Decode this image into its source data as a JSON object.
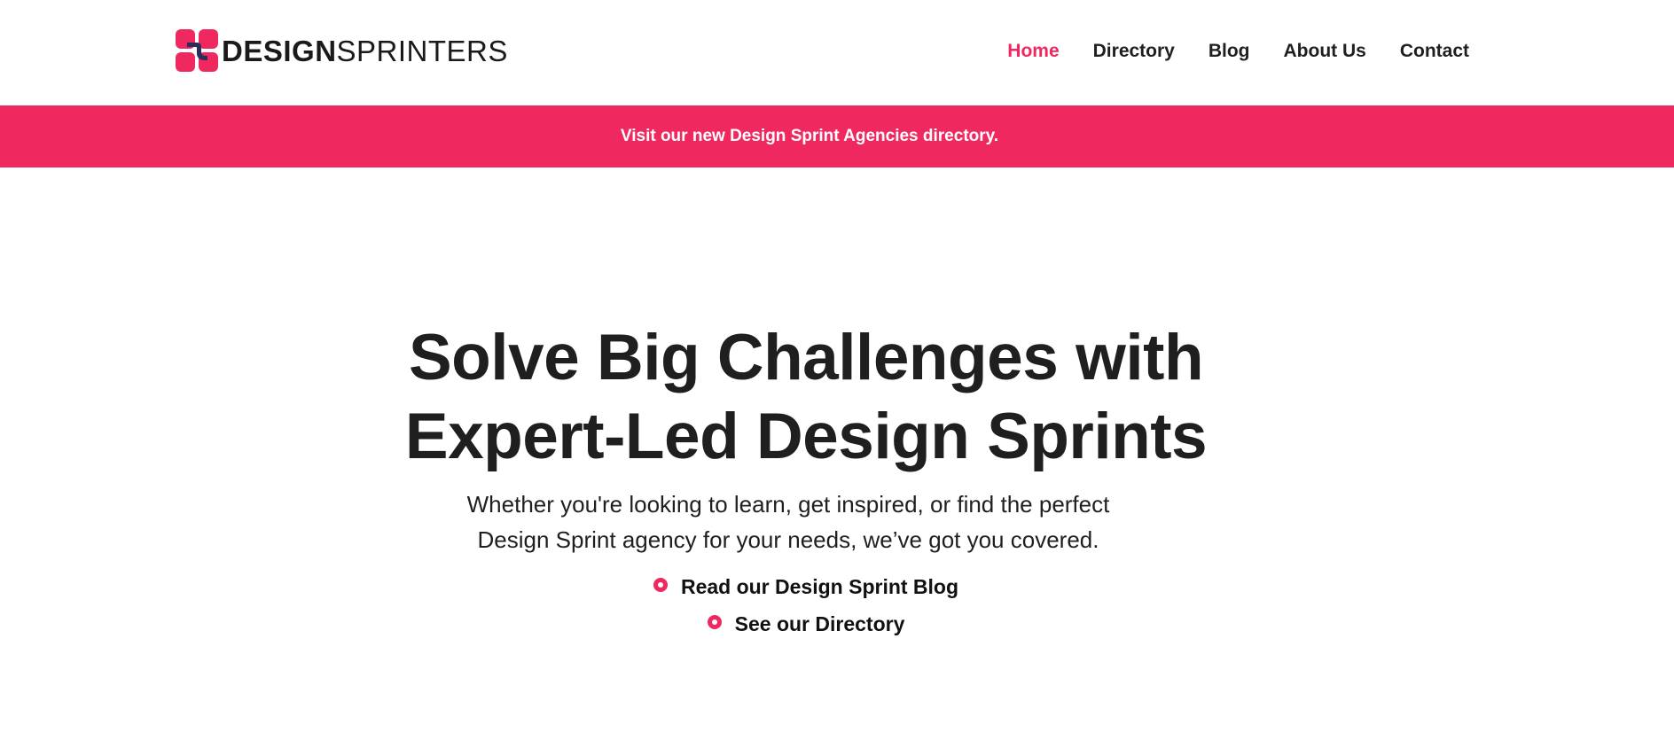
{
  "header": {
    "logo": {
      "text_bold": "DESIGN",
      "text_light": "SPRINTERS",
      "icon": "logo-mark-icon",
      "colors": {
        "pink": "#ef2960",
        "navy": "#2b2d5a"
      }
    },
    "nav": [
      {
        "label": "Home",
        "active": true
      },
      {
        "label": "Directory",
        "active": false
      },
      {
        "label": "Blog",
        "active": false
      },
      {
        "label": "About Us",
        "active": false
      },
      {
        "label": "Contact",
        "active": false
      }
    ]
  },
  "banner": {
    "text": "Visit our new Design Sprint Agencies directory.",
    "background": "#ef2960"
  },
  "hero": {
    "title_line1": "Solve Big Challenges with",
    "title_line2": "Expert-Led Design Sprints",
    "subtitle": "Whether you're looking to learn, get inspired, or find the perfect Design Sprint agency for your needs, we’ve got you covered.",
    "links": [
      {
        "label": "Read our Design Sprint Blog",
        "icon": "bullet-circle-icon"
      },
      {
        "label": "See our Directory",
        "icon": "bullet-circle-icon"
      }
    ]
  },
  "theme": {
    "accent": "#ef2960",
    "text": "#1f1f1f"
  }
}
